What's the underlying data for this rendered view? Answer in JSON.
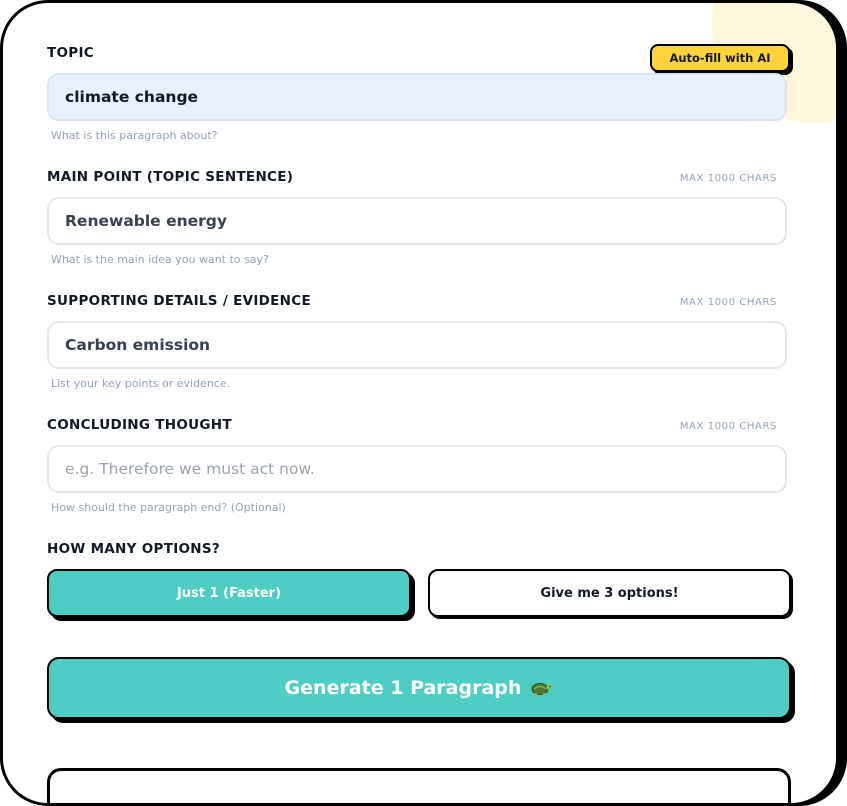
{
  "topic": {
    "label": "TOPIC",
    "autofill_label": "Auto-fill with AI",
    "value": "climate change",
    "help": "What is this paragraph about?"
  },
  "main_point": {
    "label": "MAIN POINT (TOPIC SENTENCE)",
    "max": "MAX 1000 CHARS",
    "value": "Renewable energy",
    "help": "What is the main idea you want to say?"
  },
  "supporting": {
    "label": "SUPPORTING DETAILS / EVIDENCE",
    "max": "MAX 1000 CHARS",
    "value": "Carbon emission",
    "help": "List your key points or evidence."
  },
  "concluding": {
    "label": "CONCLUDING THOUGHT",
    "max": "MAX 1000 CHARS",
    "value": "",
    "placeholder": "e.g. Therefore we must act now.",
    "help": "How should the paragraph end? (Optional)"
  },
  "options": {
    "label": "HOW MANY OPTIONS?",
    "choices": [
      {
        "label": "Just 1 (Faster)",
        "selected": true
      },
      {
        "label": "Give me 3 options!",
        "selected": false
      }
    ]
  },
  "generate": {
    "label": "Generate 1 Paragraph",
    "icon": "turtle-icon"
  },
  "colors": {
    "accent": "#4ecdc4",
    "autofill": "#ffd43b",
    "active_field": "#e8f0fe",
    "muted_text": "#94a3b8"
  }
}
